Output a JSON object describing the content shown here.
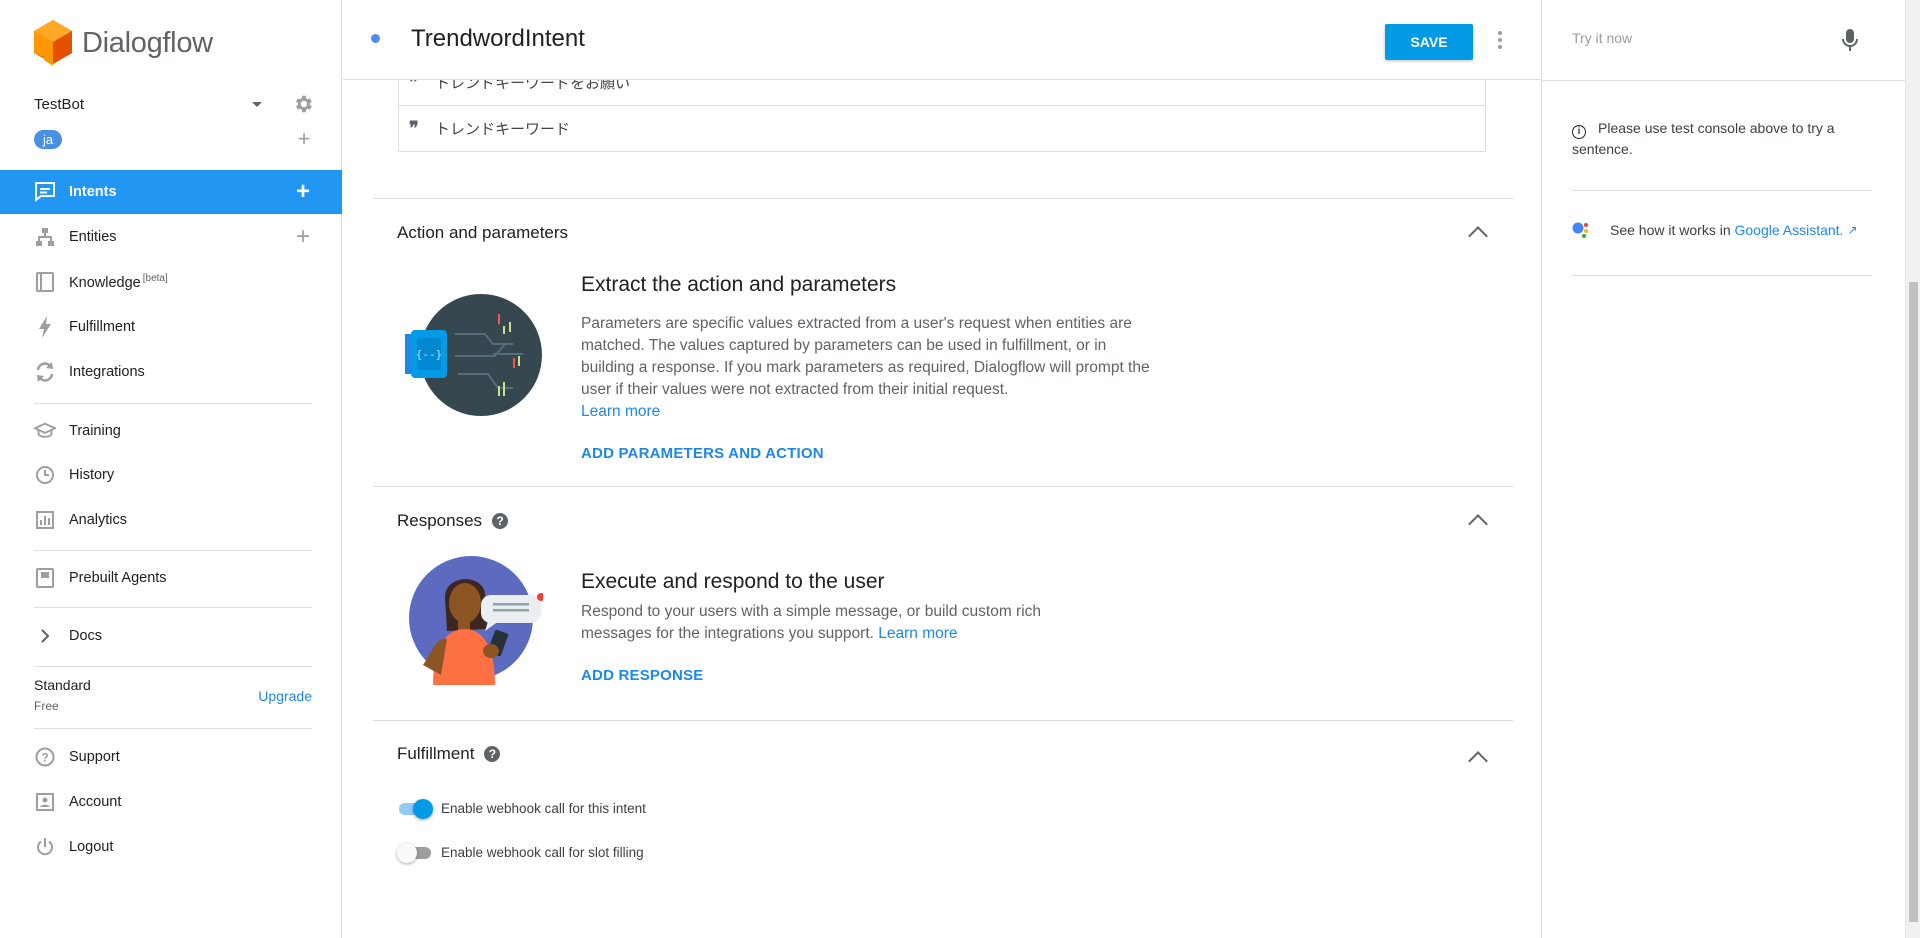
{
  "app": {
    "name": "Dialogflow"
  },
  "agent": {
    "name": "TestBot",
    "language": "ja"
  },
  "sidebar": {
    "items": [
      {
        "label": "Intents",
        "icon": "intents-icon"
      },
      {
        "label": "Entities",
        "icon": "entities-icon"
      },
      {
        "label": "Knowledge",
        "badge": "[beta]",
        "icon": "knowledge-icon"
      },
      {
        "label": "Fulfillment",
        "icon": "fulfillment-icon"
      },
      {
        "label": "Integrations",
        "icon": "integrations-icon"
      },
      {
        "label": "Training",
        "icon": "training-icon"
      },
      {
        "label": "History",
        "icon": "history-icon"
      },
      {
        "label": "Analytics",
        "icon": "analytics-icon"
      },
      {
        "label": "Prebuilt Agents",
        "icon": "prebuilt-agents-icon"
      },
      {
        "label": "Docs",
        "icon": "chevron-right-icon"
      },
      {
        "label": "Support",
        "icon": "support-icon"
      },
      {
        "label": "Account",
        "icon": "account-icon"
      },
      {
        "label": "Logout",
        "icon": "power-icon"
      }
    ],
    "plan": {
      "name": "Standard",
      "tier": "Free",
      "upgrade_label": "Upgrade"
    }
  },
  "header": {
    "intent_name": "TrendwordIntent",
    "save_label": "SAVE"
  },
  "training_phrases": [
    "トレンドキーワードをお願い",
    "トレンドキーワード"
  ],
  "sections": {
    "action": {
      "title": "Action and parameters",
      "heading": "Extract the action and parameters",
      "description": "Parameters are specific values extracted from a user's request when entities are matched. The values captured by parameters can be used in fulfillment, or in building a response. If you mark parameters as required, Dialogflow will prompt the user if their values were not extracted from their initial request.",
      "learn_more": "Learn more",
      "action_label": "ADD PARAMETERS AND ACTION"
    },
    "responses": {
      "title": "Responses",
      "heading": "Execute and respond to the user",
      "description": "Respond to your users with a simple message, or build custom rich messages for the integrations you support.",
      "learn_more": "Learn more",
      "action_label": "ADD RESPONSE"
    },
    "fulfillment": {
      "title": "Fulfillment",
      "toggles": [
        {
          "label": "Enable webhook call for this intent",
          "on": true
        },
        {
          "label": "Enable webhook call for slot filling",
          "on": false
        }
      ]
    }
  },
  "right_panel": {
    "try_placeholder": "Try it now",
    "info_text": "Please use test console above to try a sentence.",
    "ga_text": "See how it works in",
    "ga_link": "Google Assistant."
  },
  "colors": {
    "accent": "#2196f3",
    "save": "#039be5",
    "link": "#1e88e5",
    "logo": "#f57c00"
  }
}
